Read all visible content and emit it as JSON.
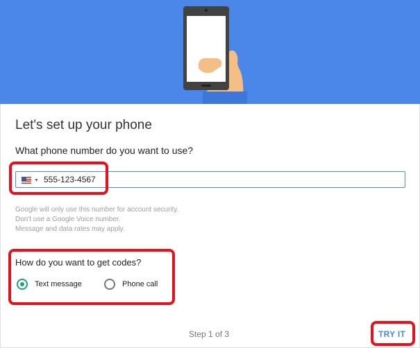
{
  "hero": {
    "image": "hand-holding-phone-illustration"
  },
  "page": {
    "title": "Let's set up your phone"
  },
  "phone": {
    "question": "What phone number do you want to use?",
    "country_flag": "us-flag-icon",
    "number": "555-123-4567",
    "hint_lines": [
      "Google will only use this number for account security.",
      "Don't use a Google Voice number.",
      "Message and data rates may apply."
    ]
  },
  "codes": {
    "question": "How do you want to get codes?",
    "options": [
      {
        "label": "Text message",
        "selected": true
      },
      {
        "label": "Phone call",
        "selected": false
      }
    ]
  },
  "footer": {
    "step_text": "Step 1 of 3",
    "try_label": "TRY IT"
  },
  "colors": {
    "banner": "#4a87e8",
    "accent": "#1e9e7d",
    "highlight": "#e8101a",
    "link": "#4a87e8"
  }
}
